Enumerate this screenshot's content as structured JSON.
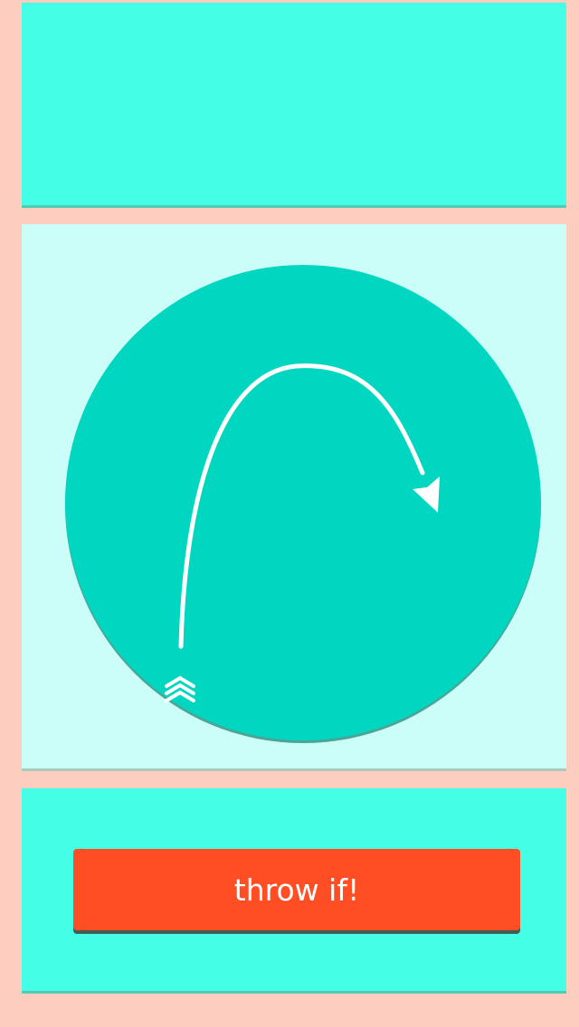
{
  "colors": {
    "background": "#FDCDC0",
    "panel_bright": "#44FFE6",
    "panel_light": "#CBFEF9",
    "dial": "#00D6C0",
    "arrow": "#FFFFFF",
    "button": "#FF4E24",
    "button_text": "#FFFFFF"
  },
  "dial": {
    "icon": "curved-arrow-icon"
  },
  "actions": {
    "throw_label": "throw if!"
  }
}
